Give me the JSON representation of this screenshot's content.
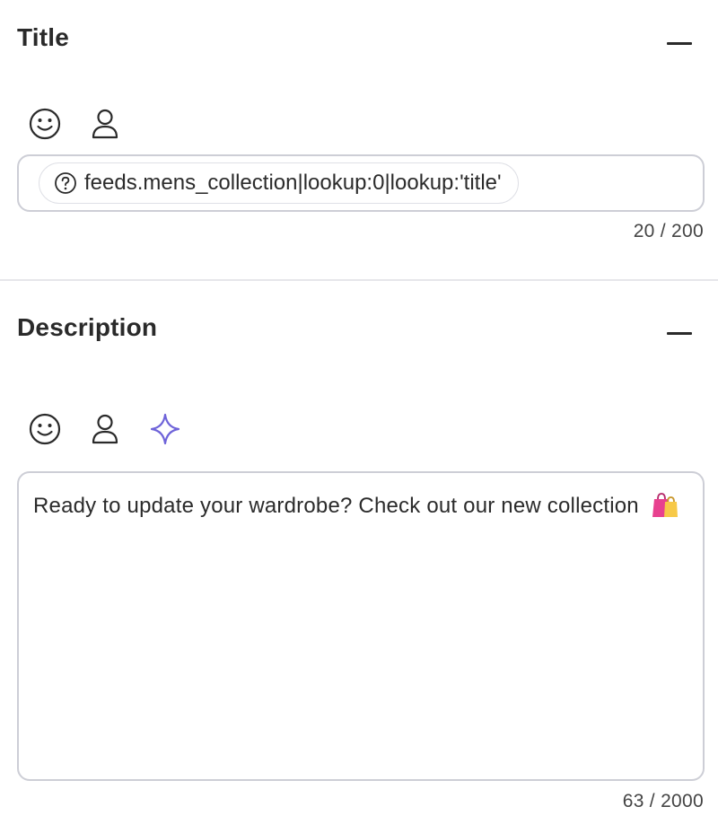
{
  "title_section": {
    "heading": "Title",
    "chip_text": "feeds.mens_collection|lookup:0|lookup:'title'",
    "counter": "20 / 200",
    "tools": [
      "emoji-icon",
      "person-icon"
    ]
  },
  "description_section": {
    "heading": "Description",
    "text": "Ready to update your wardrobe? Check out our new collection",
    "emoji": "shopping-bags",
    "counter": "63 / 2000",
    "tools": [
      "emoji-icon",
      "person-icon",
      "sparkle-icon"
    ]
  },
  "colors": {
    "sparkle": "#6e63d9",
    "border": "#cdced6",
    "emoji_bag": "#e8418f"
  }
}
